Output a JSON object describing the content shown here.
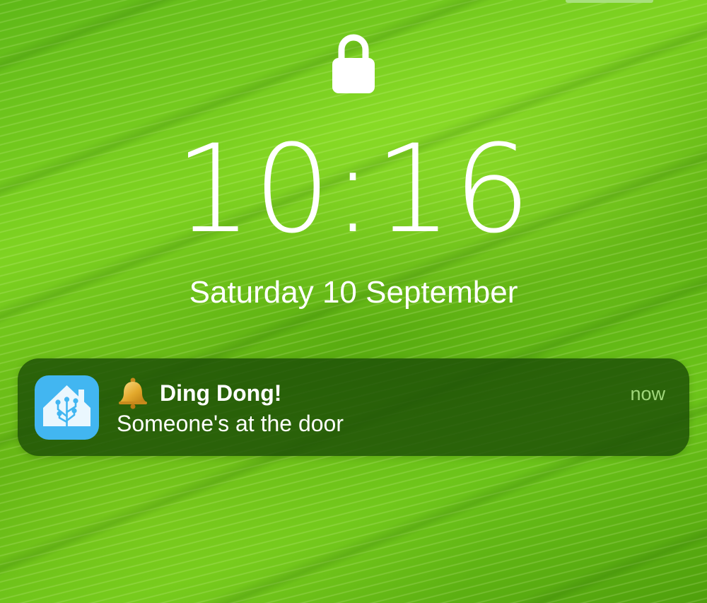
{
  "lockscreen": {
    "time": "10:16",
    "date": "Saturday 10 September"
  },
  "notification": {
    "app_icon": "home-assistant-icon",
    "title_icon": "bell-icon",
    "title": "Ding Dong!",
    "body": "Someone's at the door",
    "time": "now"
  },
  "colors": {
    "notification_background": "#1c4e06",
    "notification_time": "#9fd67a",
    "app_icon_background": "#42b6f1",
    "wallpaper": "#6cc41a",
    "text": "#ffffff"
  }
}
